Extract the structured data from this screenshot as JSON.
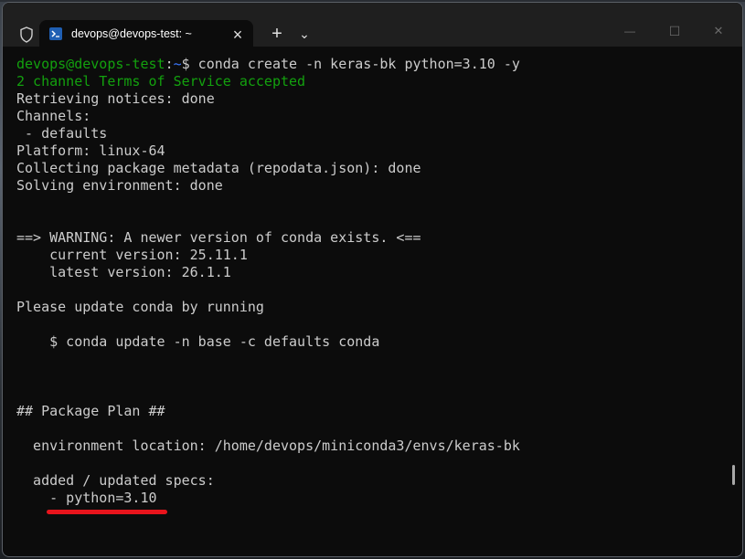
{
  "tab": {
    "title": "devops@devops-test: ~",
    "close_label": "×",
    "new_tab_label": "+",
    "dropdown_label": "⌄"
  },
  "window_controls": {
    "minimize": "—",
    "maximize": "☐",
    "close": "✕"
  },
  "terminal": {
    "prompt_user_host": "devops@devops-test",
    "prompt_sep": ":",
    "prompt_path": "~",
    "prompt_symbol": "$",
    "command": " conda create -n keras-bk python=3.10 -y",
    "tos_line": "2 channel Terms of Service accepted",
    "lines": [
      "Retrieving notices: done",
      "Channels:",
      " - defaults",
      "Platform: linux-64",
      "Collecting package metadata (repodata.json): done",
      "Solving environment: done",
      "",
      "",
      "==> WARNING: A newer version of conda exists. <==",
      "    current version: 25.11.1",
      "    latest version: 26.1.1",
      "",
      "Please update conda by running",
      "",
      "    $ conda update -n base -c defaults conda",
      "",
      "",
      "",
      "## Package Plan ##",
      "",
      "  environment location: /home/devops/miniconda3/envs/keras-bk",
      "",
      "  added / updated specs:",
      "    - python=3.10"
    ]
  },
  "colors": {
    "prompt_green": "#13a10e",
    "path_blue": "#3b78ff",
    "annotation_red": "#e8141c"
  }
}
